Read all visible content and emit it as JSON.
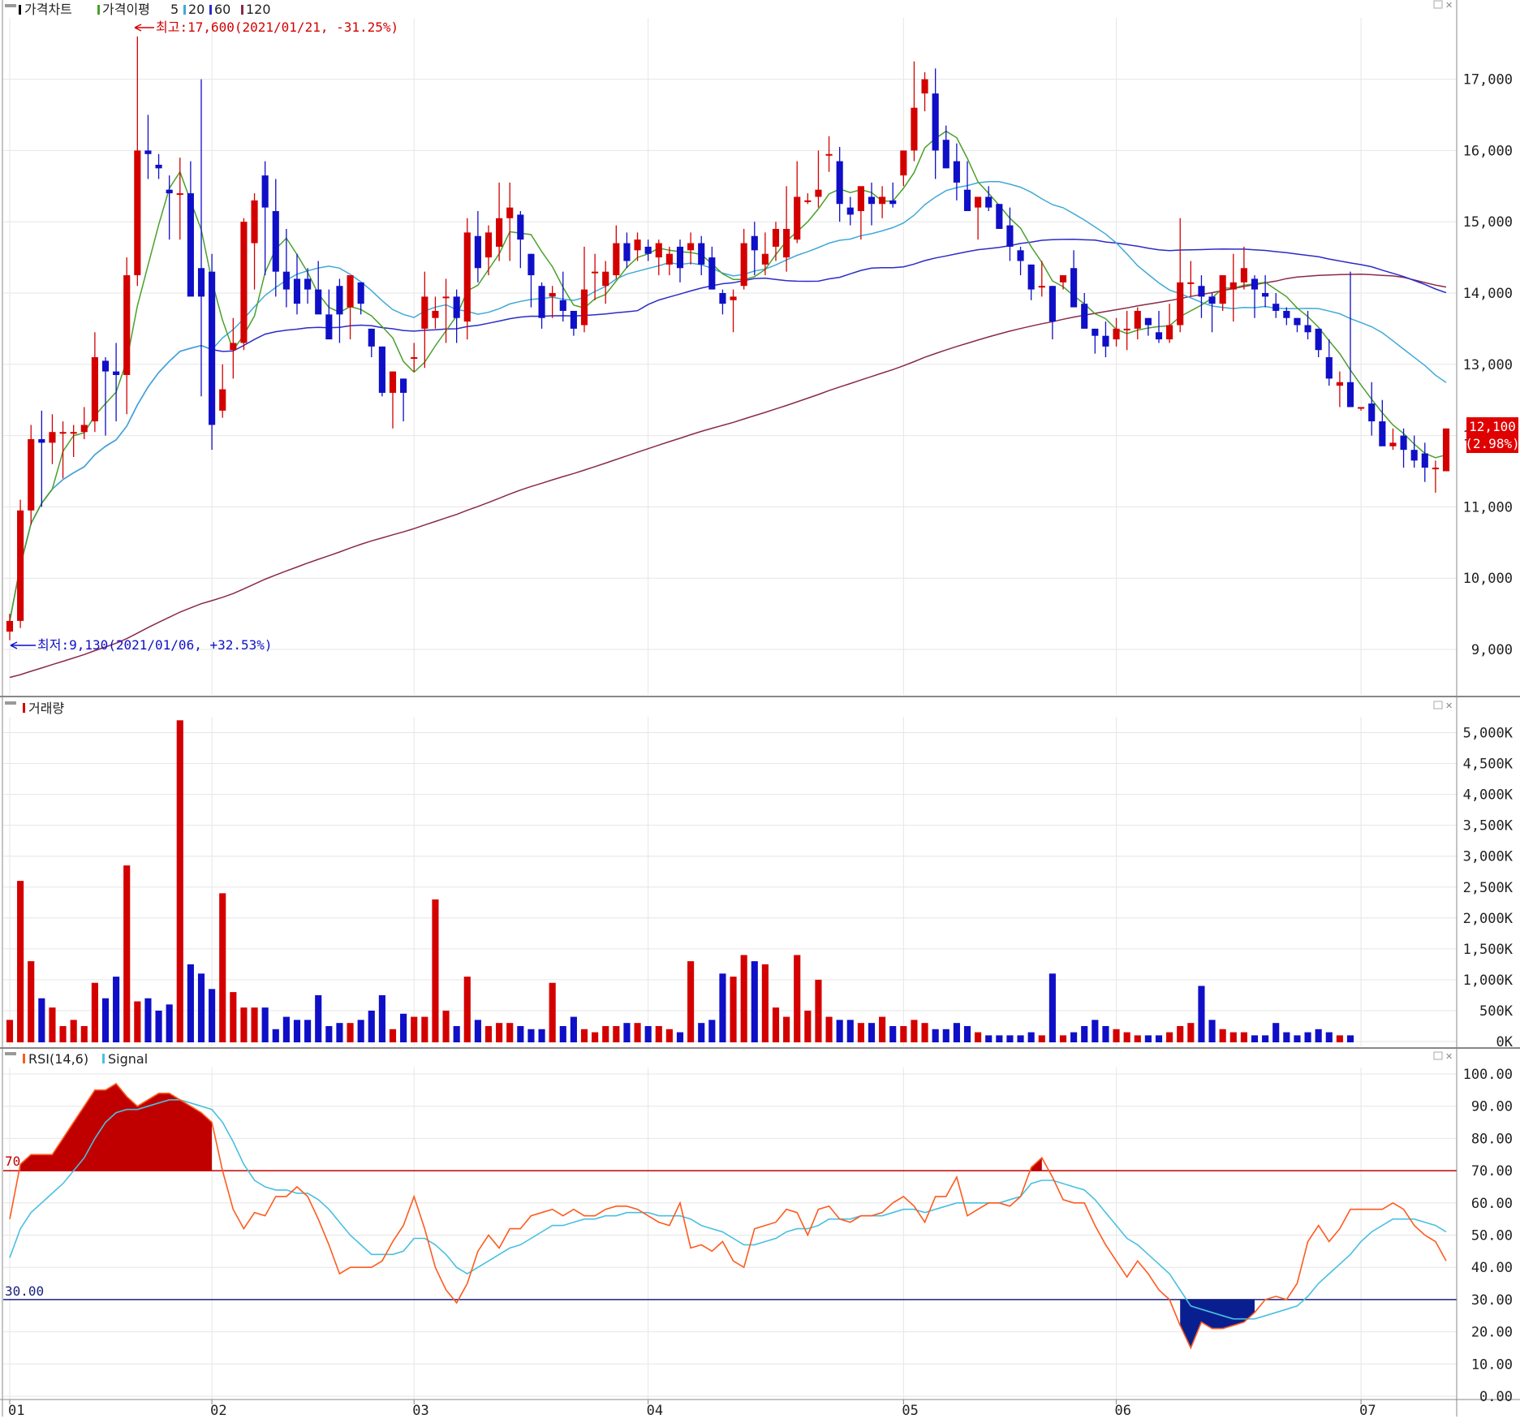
{
  "panels": {
    "price": {
      "title": "가격차트",
      "ma_label": "가격이평",
      "ma_periods": [
        "5",
        "20",
        "60",
        "120"
      ],
      "ma_colors": {
        "5": "#4aa02c",
        "20": "#3fa9d9",
        "60": "#2b2bc9",
        "120": "#8a2a4a"
      },
      "high_note": "최고:17,600(2021/01/21, -31.25%)",
      "low_note": "최저:9,130(2021/01/06, +32.53%)",
      "last_price": "12,100",
      "last_change": "(2.98%)",
      "y_ticks": [
        "9,000",
        "10,000",
        "11,000",
        "12,000",
        "13,000",
        "14,000",
        "15,000",
        "16,000",
        "17,000"
      ]
    },
    "volume": {
      "title": "거래량",
      "y_ticks": [
        "0K",
        "500K",
        "1,000K",
        "1,500K",
        "2,000K",
        "2,500K",
        "3,000K",
        "3,500K",
        "4,000K",
        "4,500K",
        "5,000K"
      ]
    },
    "rsi": {
      "title": "RSI(14,6)",
      "signal_label": "Signal",
      "upper_level_label": "70",
      "lower_level_label": "30.00",
      "y_ticks": [
        "0.00",
        "10.00",
        "20.00",
        "30.00",
        "40.00",
        "50.00",
        "60.00",
        "70.00",
        "80.00",
        "90.00",
        "100.00"
      ]
    }
  },
  "x_labels": [
    "01",
    "02",
    "03",
    "04",
    "05",
    "06",
    "07"
  ],
  "colors": {
    "up": "#d40000",
    "down": "#0f0fc8",
    "rsi": "#ff5a1e",
    "signal": "#49c0e0",
    "upper": "#c00000",
    "lower": "#1a237e",
    "grid": "#e6e6e6"
  },
  "chart_data": {
    "type": "candlestick",
    "dates": [
      "2021-01-04",
      "2021-01-05",
      "2021-01-06",
      "2021-01-07",
      "2021-01-08",
      "2021-01-11",
      "2021-01-12",
      "2021-01-13",
      "2021-01-14",
      "2021-01-15",
      "2021-01-18",
      "2021-01-19",
      "2021-01-20",
      "2021-01-21",
      "2021-01-22",
      "2021-01-25",
      "2021-01-26",
      "2021-01-27",
      "2021-01-28",
      "2021-01-29",
      "2021-02-01",
      "2021-02-02",
      "2021-02-03",
      "2021-02-04",
      "2021-02-05",
      "2021-02-08",
      "2021-02-09",
      "2021-02-10",
      "2021-02-15",
      "2021-02-16",
      "2021-02-17",
      "2021-02-18",
      "2021-02-19",
      "2021-02-22",
      "2021-02-23",
      "2021-02-24",
      "2021-02-25",
      "2021-02-26",
      "2021-03-02",
      "2021-03-03",
      "2021-03-04",
      "2021-03-05",
      "2021-03-08",
      "2021-03-09",
      "2021-03-10",
      "2021-03-11",
      "2021-03-12",
      "2021-03-15",
      "2021-03-16",
      "2021-03-17",
      "2021-03-18",
      "2021-03-19",
      "2021-03-22",
      "2021-03-23",
      "2021-03-24",
      "2021-03-25",
      "2021-03-26",
      "2021-03-29",
      "2021-03-30",
      "2021-03-31",
      "2021-04-01",
      "2021-04-02",
      "2021-04-05",
      "2021-04-06",
      "2021-04-07",
      "2021-04-08",
      "2021-04-09",
      "2021-04-12",
      "2021-04-13",
      "2021-04-14",
      "2021-04-15",
      "2021-04-16",
      "2021-04-19",
      "2021-04-20",
      "2021-04-21",
      "2021-04-22",
      "2021-04-23",
      "2021-04-26",
      "2021-04-27",
      "2021-04-28",
      "2021-04-29",
      "2021-04-30",
      "2021-05-03",
      "2021-05-04",
      "2021-05-06",
      "2021-05-07",
      "2021-05-10",
      "2021-05-11",
      "2021-05-12",
      "2021-05-13",
      "2021-05-14",
      "2021-05-17",
      "2021-05-18",
      "2021-05-20",
      "2021-05-21",
      "2021-05-24",
      "2021-05-25",
      "2021-05-26",
      "2021-05-27",
      "2021-05-28",
      "2021-05-31",
      "2021-06-01",
      "2021-06-02",
      "2021-06-03",
      "2021-06-04",
      "2021-06-07",
      "2021-06-08",
      "2021-06-09",
      "2021-06-10",
      "2021-06-11",
      "2021-06-14",
      "2021-06-15",
      "2021-06-16",
      "2021-06-17",
      "2021-06-18",
      "2021-06-21",
      "2021-06-22",
      "2021-06-23",
      "2021-06-24",
      "2021-06-25",
      "2021-06-28",
      "2021-06-29",
      "2021-06-30",
      "2021-07-01",
      "2021-07-02",
      "2021-07-05",
      "2021-07-06",
      "2021-07-07",
      "2021-07-08",
      "2021-07-09",
      "2021-07-12",
      "2021-07-13",
      "2021-07-14",
      "2021-07-15"
    ],
    "ohlc": [
      [
        9250,
        9500,
        9130,
        9400
      ],
      [
        9400,
        11100,
        9300,
        10950
      ],
      [
        10950,
        12150,
        10750,
        11950
      ],
      [
        11950,
        12350,
        11000,
        11900
      ],
      [
        11900,
        12300,
        11600,
        12050
      ],
      [
        12050,
        12200,
        11400,
        12050
      ],
      [
        12050,
        12150,
        11700,
        12050
      ],
      [
        12050,
        12400,
        11950,
        12150
      ],
      [
        12200,
        13450,
        12050,
        13100
      ],
      [
        13050,
        13100,
        12000,
        12900
      ],
      [
        12900,
        13300,
        12200,
        12850
      ],
      [
        12850,
        14500,
        12300,
        14250
      ],
      [
        14250,
        17600,
        14100,
        16000
      ],
      [
        16000,
        16500,
        15600,
        15950
      ],
      [
        15800,
        15950,
        15600,
        15750
      ],
      [
        15450,
        15650,
        14750,
        15400
      ],
      [
        15400,
        15900,
        14750,
        15400
      ],
      [
        15400,
        15850,
        14200,
        13950
      ],
      [
        14350,
        17000,
        12550,
        13950
      ],
      [
        14300,
        14550,
        11800,
        12150
      ],
      [
        12350,
        13000,
        12250,
        12650
      ],
      [
        13200,
        13650,
        12800,
        13300
      ],
      [
        13300,
        15050,
        13200,
        15000
      ],
      [
        14700,
        15400,
        14050,
        15300
      ],
      [
        15650,
        15850,
        14250,
        15200
      ],
      [
        15150,
        15600,
        13950,
        14300
      ],
      [
        14300,
        14900,
        13800,
        14050
      ],
      [
        14200,
        14550,
        13700,
        13850
      ],
      [
        14200,
        14350,
        13850,
        14050
      ],
      [
        14050,
        14450,
        13850,
        13700
      ],
      [
        13700,
        14050,
        13450,
        13350
      ],
      [
        14100,
        14200,
        13300,
        13700
      ],
      [
        13800,
        14200,
        13350,
        14250
      ],
      [
        14150,
        14150,
        13700,
        13850
      ],
      [
        13500,
        13500,
        13100,
        13250
      ],
      [
        13250,
        13250,
        12550,
        12600
      ],
      [
        12600,
        12900,
        12100,
        12900
      ],
      [
        12800,
        12800,
        12200,
        12600
      ],
      [
        13100,
        13300,
        12900,
        13100
      ],
      [
        13500,
        14300,
        12950,
        13950
      ],
      [
        13650,
        13950,
        13500,
        13750
      ],
      [
        13950,
        14200,
        13300,
        13950
      ],
      [
        13950,
        14050,
        13300,
        13650
      ],
      [
        13600,
        15050,
        13350,
        14850
      ],
      [
        14800,
        15150,
        14150,
        14350
      ],
      [
        14500,
        14950,
        14250,
        14850
      ],
      [
        14650,
        15550,
        14450,
        15050
      ],
      [
        15050,
        15550,
        14450,
        15200
      ],
      [
        15100,
        15150,
        14350,
        14750
      ],
      [
        14550,
        14550,
        13800,
        14250
      ],
      [
        14100,
        14150,
        13500,
        13650
      ],
      [
        13950,
        14100,
        13650,
        14000
      ],
      [
        13900,
        14300,
        13600,
        13750
      ],
      [
        13750,
        13750,
        13400,
        13500
      ],
      [
        13550,
        14650,
        13450,
        14050
      ],
      [
        14300,
        14550,
        13900,
        14300
      ],
      [
        14100,
        14450,
        13850,
        14300
      ],
      [
        14250,
        14950,
        14200,
        14700
      ],
      [
        14700,
        14850,
        14350,
        14450
      ],
      [
        14600,
        14850,
        14450,
        14750
      ],
      [
        14650,
        14750,
        14450,
        14550
      ],
      [
        14500,
        14750,
        14250,
        14700
      ],
      [
        14400,
        14650,
        14250,
        14550
      ],
      [
        14650,
        14750,
        14150,
        14350
      ],
      [
        14600,
        14850,
        14400,
        14700
      ],
      [
        14700,
        14800,
        14250,
        14400
      ],
      [
        14500,
        14650,
        14050,
        14050
      ],
      [
        14000,
        14050,
        13700,
        13850
      ],
      [
        13900,
        14050,
        13450,
        13950
      ],
      [
        14100,
        14900,
        14050,
        14700
      ],
      [
        14800,
        15000,
        14250,
        14600
      ],
      [
        14400,
        14850,
        14250,
        14550
      ],
      [
        14650,
        15000,
        14450,
        14900
      ],
      [
        14500,
        15500,
        14300,
        14900
      ],
      [
        14750,
        15850,
        14700,
        15350
      ],
      [
        15300,
        15400,
        15250,
        15300
      ],
      [
        15350,
        16000,
        15200,
        15450
      ],
      [
        15950,
        16200,
        15700,
        15950
      ],
      [
        15850,
        16050,
        15000,
        15250
      ],
      [
        15200,
        15350,
        14950,
        15100
      ],
      [
        15150,
        15300,
        14750,
        15500
      ],
      [
        15350,
        15550,
        14950,
        15250
      ],
      [
        15250,
        15500,
        15050,
        15350
      ],
      [
        15300,
        15550,
        15200,
        15250
      ],
      [
        15650,
        16000,
        15500,
        16000
      ],
      [
        16000,
        17250,
        15850,
        16600
      ],
      [
        16800,
        17100,
        16550,
        17000
      ],
      [
        16800,
        17150,
        15600,
        16000
      ],
      [
        16150,
        16350,
        15750,
        15750
      ],
      [
        15850,
        16100,
        15300,
        15550
      ],
      [
        15450,
        15850,
        15200,
        15150
      ],
      [
        15200,
        15350,
        14750,
        15350
      ],
      [
        15350,
        15500,
        15150,
        15200
      ],
      [
        15250,
        15250,
        14900,
        14900
      ],
      [
        14950,
        15200,
        14450,
        14650
      ],
      [
        14600,
        14650,
        14250,
        14450
      ],
      [
        14400,
        14400,
        13900,
        14050
      ],
      [
        14100,
        14450,
        13950,
        14100
      ],
      [
        14100,
        14100,
        13350,
        13600
      ],
      [
        14150,
        14200,
        14050,
        14250
      ],
      [
        14350,
        14600,
        13850,
        13800
      ],
      [
        13850,
        14000,
        13500,
        13500
      ],
      [
        13500,
        13500,
        13150,
        13400
      ],
      [
        13400,
        13600,
        13100,
        13250
      ],
      [
        13350,
        13650,
        13250,
        13500
      ],
      [
        13500,
        13750,
        13200,
        13500
      ],
      [
        13500,
        13800,
        13350,
        13750
      ],
      [
        13650,
        13650,
        13400,
        13550
      ],
      [
        13450,
        13750,
        13300,
        13350
      ],
      [
        13350,
        13850,
        13300,
        13550
      ],
      [
        13550,
        15050,
        13450,
        14150
      ],
      [
        14150,
        14450,
        13950,
        14150
      ],
      [
        14100,
        14250,
        13650,
        13950
      ],
      [
        13950,
        14000,
        13450,
        13850
      ],
      [
        13850,
        14250,
        13750,
        14250
      ],
      [
        14050,
        14550,
        13600,
        14150
      ],
      [
        14150,
        14650,
        14050,
        14350
      ],
      [
        14200,
        14250,
        13650,
        14050
      ],
      [
        14000,
        14250,
        13800,
        13950
      ],
      [
        13850,
        14000,
        13650,
        13750
      ],
      [
        13750,
        13800,
        13550,
        13650
      ],
      [
        13650,
        13650,
        13450,
        13550
      ],
      [
        13550,
        13750,
        13350,
        13450
      ],
      [
        13500,
        13500,
        13100,
        13200
      ],
      [
        13100,
        13350,
        12700,
        12800
      ],
      [
        12700,
        12900,
        12400,
        12750
      ],
      [
        12750,
        14300,
        12550,
        12400
      ],
      [
        12400,
        12400,
        12350,
        12400
      ],
      [
        12450,
        12750,
        12000,
        12200
      ],
      [
        12200,
        12500,
        11900,
        11850
      ],
      [
        11850,
        12100,
        11800,
        11900
      ],
      [
        12000,
        12100,
        11550,
        11800
      ],
      [
        11800,
        12000,
        11550,
        11650
      ],
      [
        11750,
        11900,
        11350,
        11550
      ],
      [
        11550,
        11650,
        11200,
        11550
      ],
      [
        11500,
        12100,
        11500,
        12100
      ]
    ],
    "volume_k": [
      350,
      2600,
      1300,
      700,
      550,
      250,
      350,
      250,
      950,
      700,
      1050,
      2850,
      650,
      700,
      500,
      600,
      5200,
      1250,
      1100,
      850,
      2400,
      800,
      550,
      550,
      550,
      200,
      400,
      350,
      350,
      750,
      250,
      300,
      300,
      350,
      500,
      750,
      200,
      450,
      400,
      400,
      2300,
      500,
      250,
      1050,
      350,
      250,
      300,
      300,
      250,
      200,
      200,
      950,
      250,
      400,
      200,
      150,
      250,
      250,
      300,
      300,
      250,
      250,
      200,
      150,
      1300,
      300,
      350,
      1100,
      1050,
      1400,
      1300,
      1250,
      550,
      400,
      1400,
      500,
      1000,
      400,
      350,
      350,
      300,
      300,
      400,
      250,
      250,
      350,
      300,
      200,
      200,
      300,
      250,
      150,
      100,
      100,
      100,
      100,
      150,
      100,
      1100,
      100,
      150,
      250,
      350,
      250,
      200,
      150,
      100,
      100,
      100,
      150,
      250,
      300,
      900,
      350,
      200,
      150,
      150,
      100,
      100,
      300,
      150,
      100,
      150,
      200,
      150,
      100,
      100
    ],
    "rsi": [
      55,
      72,
      75,
      75,
      75,
      80,
      85,
      90,
      95,
      95,
      97,
      93,
      90,
      92,
      94,
      94,
      92,
      90,
      88,
      85,
      70,
      58,
      52,
      57,
      56,
      62,
      62,
      65,
      62,
      55,
      47,
      38,
      40,
      40,
      40,
      42,
      48,
      53,
      62,
      52,
      40,
      33,
      29,
      35,
      45,
      50,
      46,
      52,
      52,
      56,
      57,
      58,
      56,
      58,
      56,
      56,
      58,
      59,
      59,
      58,
      56,
      54,
      53,
      60,
      46,
      47,
      45,
      48,
      42,
      40,
      52,
      53,
      54,
      58,
      57,
      50,
      58,
      59,
      55,
      54,
      56,
      56,
      57,
      60,
      62,
      59,
      54,
      62,
      62,
      68,
      56,
      58,
      60,
      60,
      59,
      62,
      71,
      74,
      68,
      61,
      60,
      60,
      53,
      47,
      42,
      37,
      42,
      38,
      33,
      30,
      22,
      15,
      23,
      21,
      21,
      22,
      23,
      26,
      30,
      31,
      30,
      35,
      48,
      53,
      48,
      52,
      58,
      58,
      58,
      58,
      60,
      58,
      53,
      50,
      48,
      42,
      36,
      30,
      25,
      34,
      38,
      33,
      25,
      25,
      24,
      20,
      21,
      22,
      23,
      24,
      25,
      29,
      44
    ],
    "signal": [
      43,
      52,
      57,
      60,
      63,
      66,
      70,
      74,
      80,
      85,
      88,
      89,
      89,
      90,
      91,
      92,
      92,
      91,
      90,
      89,
      85,
      79,
      72,
      67,
      65,
      64,
      64,
      63,
      63,
      61,
      58,
      54,
      50,
      47,
      44,
      44,
      44,
      45,
      49,
      49,
      47,
      44,
      40,
      38,
      40,
      42,
      44,
      46,
      47,
      49,
      51,
      53,
      53,
      54,
      55,
      55,
      56,
      56,
      57,
      57,
      57,
      56,
      56,
      56,
      55,
      53,
      52,
      51,
      49,
      47,
      47,
      48,
      49,
      51,
      52,
      52,
      53,
      55,
      55,
      55,
      56,
      56,
      56,
      57,
      58,
      58,
      57,
      58,
      59,
      60,
      60,
      60,
      60,
      60,
      61,
      62,
      66,
      67,
      67,
      66,
      65,
      64,
      61,
      57,
      53,
      49,
      47,
      44,
      41,
      38,
      33,
      28,
      27,
      26,
      25,
      24,
      24,
      24,
      25,
      26,
      27,
      28,
      31,
      35,
      38,
      41,
      44,
      48,
      51,
      53,
      55,
      55,
      55,
      54,
      53,
      51,
      48,
      45,
      40,
      39,
      38,
      37,
      34,
      31,
      29,
      27,
      25,
      24,
      24,
      24,
      24,
      26,
      32
    ]
  }
}
